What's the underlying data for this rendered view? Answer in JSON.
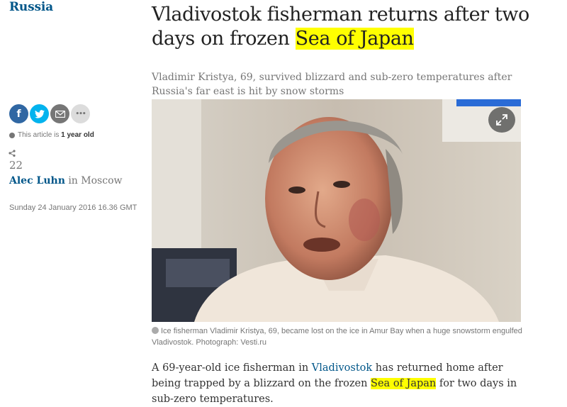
{
  "section": {
    "label": "Russia"
  },
  "headline": {
    "before": "Vladivostok fisherman returns after two days on frozen ",
    "highlight": "Sea of Japan"
  },
  "standfirst": "Vladimir Kristya, 69, survived blizzard and sub-zero temperatures after Russia's far east is hit by snow storms",
  "share": {
    "facebook_icon": "facebook-icon",
    "twitter_icon": "twitter-icon",
    "email_icon": "email-icon",
    "more_icon": "more-icon",
    "facebook_glyph": "f",
    "more_glyph": "•••"
  },
  "age_notice": {
    "prefix": "This article is ",
    "value": "1 year old"
  },
  "shares": {
    "count": "22"
  },
  "byline": {
    "author": "Alec Luhn",
    "connector": " in ",
    "location": "Moscow"
  },
  "dateline": "Sunday 24 January 2016 16.36 GMT",
  "caption": "Ice fisherman Vladimir Kristya, 69, became lost on the ice in Amur Bay when a huge snowstorm engulfed Vladivostok. Photograph: Vesti.ru",
  "body": {
    "p1_a": "A 69-year-old ice fisherman in ",
    "p1_link": "Vladivostok",
    "p1_b": " has returned home after being trapped by a blizzard on the frozen ",
    "p1_highlight": "Sea of Japan",
    "p1_c": " for two days in sub-zero temperatures."
  },
  "colors": {
    "accent": "#005689",
    "highlight": "#ffff00",
    "facebook": "#3067a3",
    "twitter": "#03b3ee"
  }
}
